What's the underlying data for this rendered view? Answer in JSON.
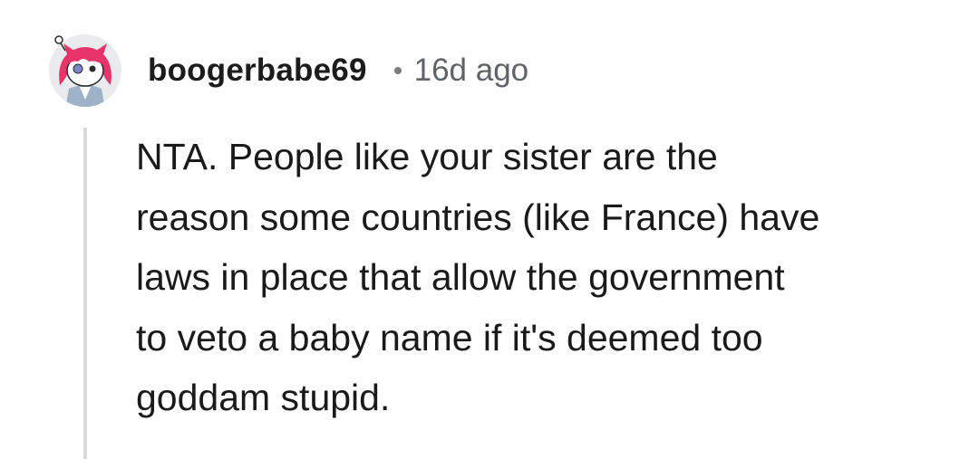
{
  "comment": {
    "author": {
      "username": "boogerbabe69",
      "avatar_icon": "snoo-avatar-icon"
    },
    "separator": "•",
    "timestamp": "16d ago",
    "body": "NTA. People like your sister are the\nreason some countries (like France) have\nlaws in place that allow the government\nto veto a baby name if it's deemed too\ngoddam stupid."
  },
  "colors": {
    "username": "#1c1c1c",
    "timestamp": "#5f6368",
    "body_text": "#1a1a1b",
    "thread_line": "#dadada",
    "avatar_background": "#e9ebec",
    "avatar_hair": "#e8336b"
  }
}
